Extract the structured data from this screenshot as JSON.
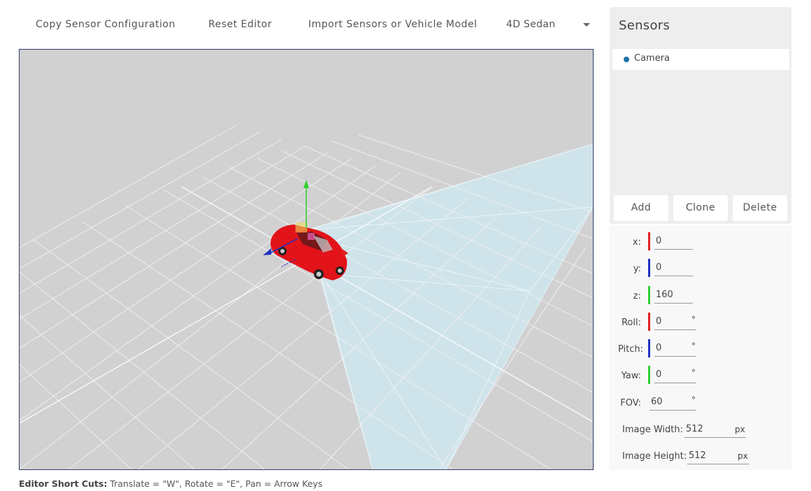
{
  "toolbar": {
    "copy_label": "Copy Sensor Configuration",
    "reset_label": "Reset Editor",
    "import_label": "Import Sensors or Vehicle Model",
    "vehicle_select_value": "4D Sedan"
  },
  "sensors_panel": {
    "title": "Sensors",
    "items": [
      {
        "label": "Camera"
      }
    ],
    "add_label": "Add",
    "clone_label": "Clone",
    "delete_label": "Delete"
  },
  "properties": {
    "x": {
      "label": "x:",
      "value": "0"
    },
    "y": {
      "label": "y:",
      "value": "0"
    },
    "z": {
      "label": "z:",
      "value": "160"
    },
    "roll": {
      "label": "Roll:",
      "value": "0",
      "unit": "°"
    },
    "pitch": {
      "label": "Pitch:",
      "value": "0",
      "unit": "°"
    },
    "yaw": {
      "label": "Yaw:",
      "value": "0",
      "unit": "°"
    },
    "fov": {
      "label": "FOV:",
      "value": "60",
      "unit": "°"
    },
    "image_width": {
      "label": "Image Width:",
      "value": "512",
      "unit": "px"
    },
    "image_height": {
      "label": "Image Height:",
      "value": "512",
      "unit": "px"
    }
  },
  "footer": {
    "shortcuts_title": "Editor Short Cuts:",
    "shortcuts_text": " Translate = \"W\", Rotate = \"E\", Pan = Arrow Keys"
  },
  "colors": {
    "x_axis": "#e02020",
    "y_axis": "#2030c0",
    "z_axis": "#30d030",
    "viewport_bg": "#d2d1d2",
    "frustum": "#cfe3ea",
    "sensor_dot": "#1a73a8"
  }
}
